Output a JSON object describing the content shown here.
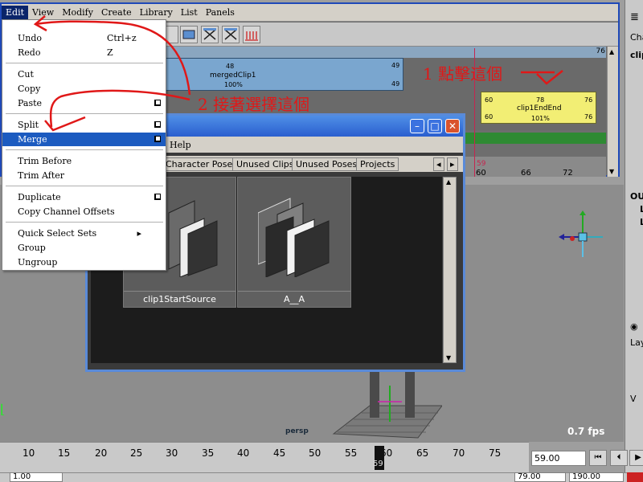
{
  "trax": {
    "menus": [
      "Edit",
      "View",
      "Modify",
      "Create",
      "Library",
      "List",
      "Panels"
    ],
    "end_frame": "76",
    "clip_merged": {
      "top_frame": "48",
      "name": "mergedClip1",
      "percent": "100%",
      "start": "49",
      "end": "49"
    },
    "clip_end": {
      "start": "60",
      "mid": "78",
      "end": "76",
      "name": "clip1EndEnd",
      "start2": "60",
      "percent": "101%",
      "end2": "76"
    },
    "current_frame_marker": "59",
    "ruler_labels": [
      "60",
      "66",
      "72"
    ]
  },
  "edit_menu": {
    "items": [
      {
        "label": "Undo",
        "accel": "Ctrl+z"
      },
      {
        "label": "Redo",
        "accel": "Z"
      },
      {
        "label": "Cut"
      },
      {
        "label": "Copy"
      },
      {
        "label": "Paste"
      },
      {
        "label": "Split"
      },
      {
        "label": "Merge"
      },
      {
        "label": "Trim Before"
      },
      {
        "label": "Trim After"
      },
      {
        "label": "Duplicate"
      },
      {
        "label": "Copy Channel Offsets"
      },
      {
        "label": "Quick Select Sets"
      },
      {
        "label": "Group"
      },
      {
        "label": "Ungroup"
      }
    ]
  },
  "annotations": {
    "step1": "1 點擊這個",
    "step2": "2 接著選擇這個"
  },
  "visor": {
    "help_menu": "Help",
    "tabs": [
      "Character Poses",
      "Unused Clips",
      "Unused Poses",
      "Projects"
    ],
    "thumbs": [
      {
        "label": "clip1StartSource"
      },
      {
        "label": "A__A"
      }
    ]
  },
  "right_panel": {
    "top_label": "Cha",
    "clip_label": "clip",
    "out_label": "OU",
    "l1": "L",
    "l2": "L",
    "lay_label": "Lay",
    "v_label": "V"
  },
  "viewport": {
    "camera": "persp",
    "fps": "0.7 fps"
  },
  "timeline": {
    "ticks": [
      "10",
      "15",
      "20",
      "25",
      "30",
      "35",
      "40",
      "45",
      "50",
      "55",
      "60",
      "65",
      "70",
      "75"
    ],
    "current_label": "59",
    "current_time": "59.00",
    "range_start": "1.00",
    "range_end_a": "79.00",
    "range_end_b": "190.00"
  },
  "colors": {
    "title_blue": "#2a5ecf",
    "menu_select": "#1c5bc0",
    "clip_blue": "#7aa6cf",
    "clip_yellow": "#f2ee74",
    "annotation_red": "#e01818",
    "track_green": "#2f8a33"
  }
}
